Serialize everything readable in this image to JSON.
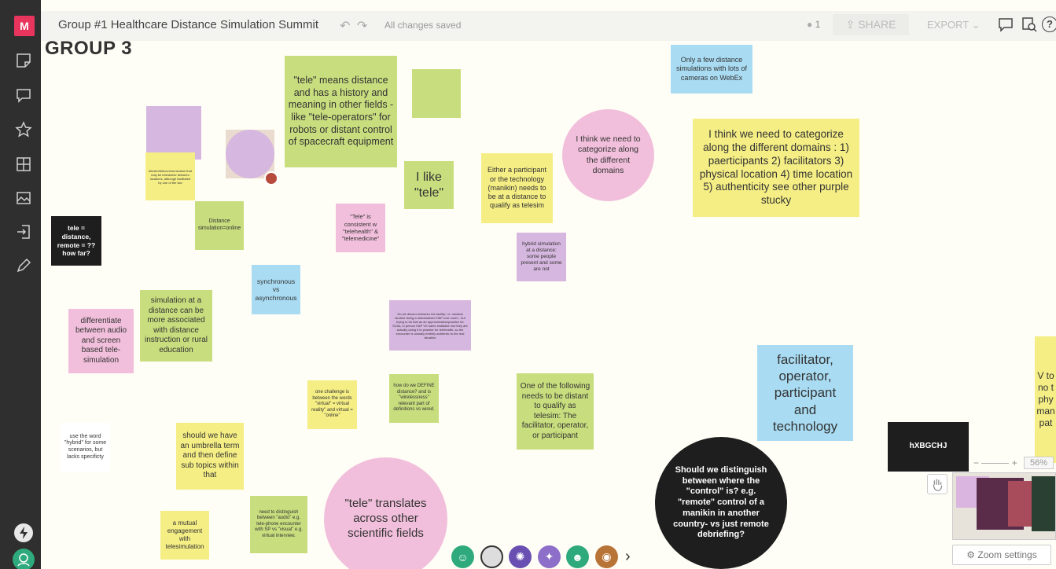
{
  "app": {
    "logo": "M"
  },
  "toolbar": {
    "title": "Group #1 Healthcare Distance Simulation Summit",
    "saved_status": "All changes saved",
    "user_count": "1",
    "share_label": "SHARE",
    "export_label": "EXPORT",
    "help_label": "?"
  },
  "board": {
    "group_title": "GROUP 3",
    "notes": {
      "tele_distance": "\"tele\" means distance and has a history and meaning in other fields - like \"tele-operators\" for robots or distant control of spacecraft equipment",
      "webex": "Only a few distance simulations with lots of cameras on WebEx",
      "i_like_tele": "I like \"tele\"",
      "either_participant": "Either a participant or the technology (manikin) needs to be at a distance to qualify as telesim",
      "categorize_circle": "I think we need to categorize along the different domains",
      "categorize_long": "I think we need to categorize along the different domains : 1) paerticipants 2) facilitators 3) physical location 4) time location 5) authenticity see other purple stucky",
      "tele_consistent": "\"Tele\" is consistent w \"telehealth\" & \"telemedicine\"",
      "hybrid_sim": "hybrid simulation at a distance: some people present and some are not",
      "distance_online": "Distance simulation=online",
      "tele_question": "tele = distance, remote = ?? how far?",
      "sync_async": "synchronous vs asynchronous",
      "telecomm_small": "telesim/telecommunication that may be interactive between locations, although facilitated by one of the two",
      "distinction_small": "Do we discern between the facility: i.e. medical student doing a standardized H&P over zoom - but trying to do that as an approximation/practice for SCAs, in person H&P VS same institution but they are actually doing it to practice for telehealth- so the encounter is actually entirely authentic to the real situation",
      "differentiate": "differentiate between audio and screen based tele-simulation",
      "sim_distance": "simulation at a distance can be more associated with distance instruction or rural education",
      "challenge": "one challenge is between the words \"virtual\" = virtual reality\" and virtual = \"online\"",
      "how_define": "how do we DEFINE distance? and is \"wirelessness\" relevant part of definitions vs wired.",
      "one_following": "One of the following needs to be distant to qualify as telesim: The facilitator, operator, or participant",
      "facilitator_list": "facilitator, operator, participant and technology",
      "hybrid_word": "use the word \"hybrid\" for some scenarios, but lacks specificty",
      "umbrella": "should we have an umbrella term and then define sub topics within that",
      "tele_translates": "\"tele\" translates across other scientific fields",
      "control_question": "Should we distinguish between where the \"control\" is? e.g. \"remote\" control of a manikin in another country- vs just remote debriefing?",
      "hxbg": "hXBGCHJ",
      "mutual": "a mutual engagement with telesimulation",
      "audio_visual": "need to distinguish between \"audio\" e.g. tele-phone encounter with SP vs \"visual\" e.g. virtual interview.",
      "partial_right": "V to no t phy man pat"
    }
  },
  "zoom": {
    "percent": "56%",
    "settings_label": "Zoom settings",
    "minus": "−",
    "plus": "+"
  },
  "colors": {
    "yellow": "#f5ee85",
    "green": "#c8de7e",
    "pink": "#f1bfdb",
    "purple": "#d6b7df",
    "blue": "#a9dcf3",
    "black": "#1e1e1e",
    "brand": "#e8355e"
  },
  "icons": [
    "sticky-note-icon",
    "comment-icon",
    "star-icon",
    "grid-icon",
    "image-icon",
    "import-icon",
    "pen-icon",
    "lightning-icon",
    "user-avatar-icon",
    "chat-icon",
    "search-icon",
    "hand-icon",
    "gear-icon"
  ]
}
